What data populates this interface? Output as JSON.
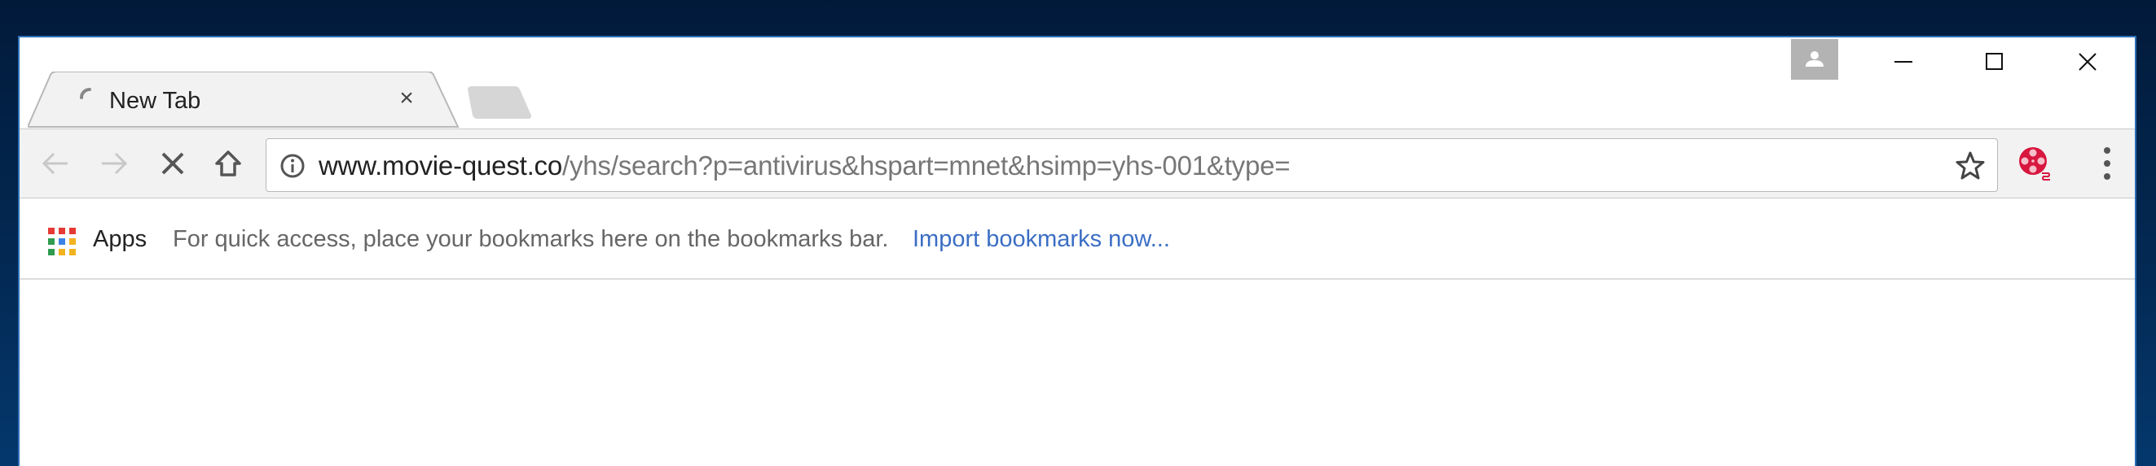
{
  "tab": {
    "title": "New Tab",
    "close_icon": "close-icon",
    "loading_icon": "spinner-icon"
  },
  "window_controls": {
    "profile": "person-icon",
    "minimize": "minimize-icon",
    "maximize": "maximize-icon",
    "close": "close-icon"
  },
  "toolbar": {
    "back": "arrow-left-icon",
    "forward": "arrow-right-icon",
    "stop": "stop-icon",
    "home": "home-icon",
    "url_host": "www.movie-quest.co",
    "url_path": "/yhs/search?p=antivirus&hspart=mnet&hsimp=yhs-001&type=",
    "bookmark_star": "star-icon",
    "extension": "film-reel-icon",
    "menu": "more-vert-icon",
    "extension_color": "#d8173f"
  },
  "bookmarks_bar": {
    "apps_label": "Apps",
    "hint": "For quick access, place your bookmarks here on the bookmarks bar.",
    "import_link": "Import bookmarks now...",
    "link_color": "#3b6ec4"
  }
}
